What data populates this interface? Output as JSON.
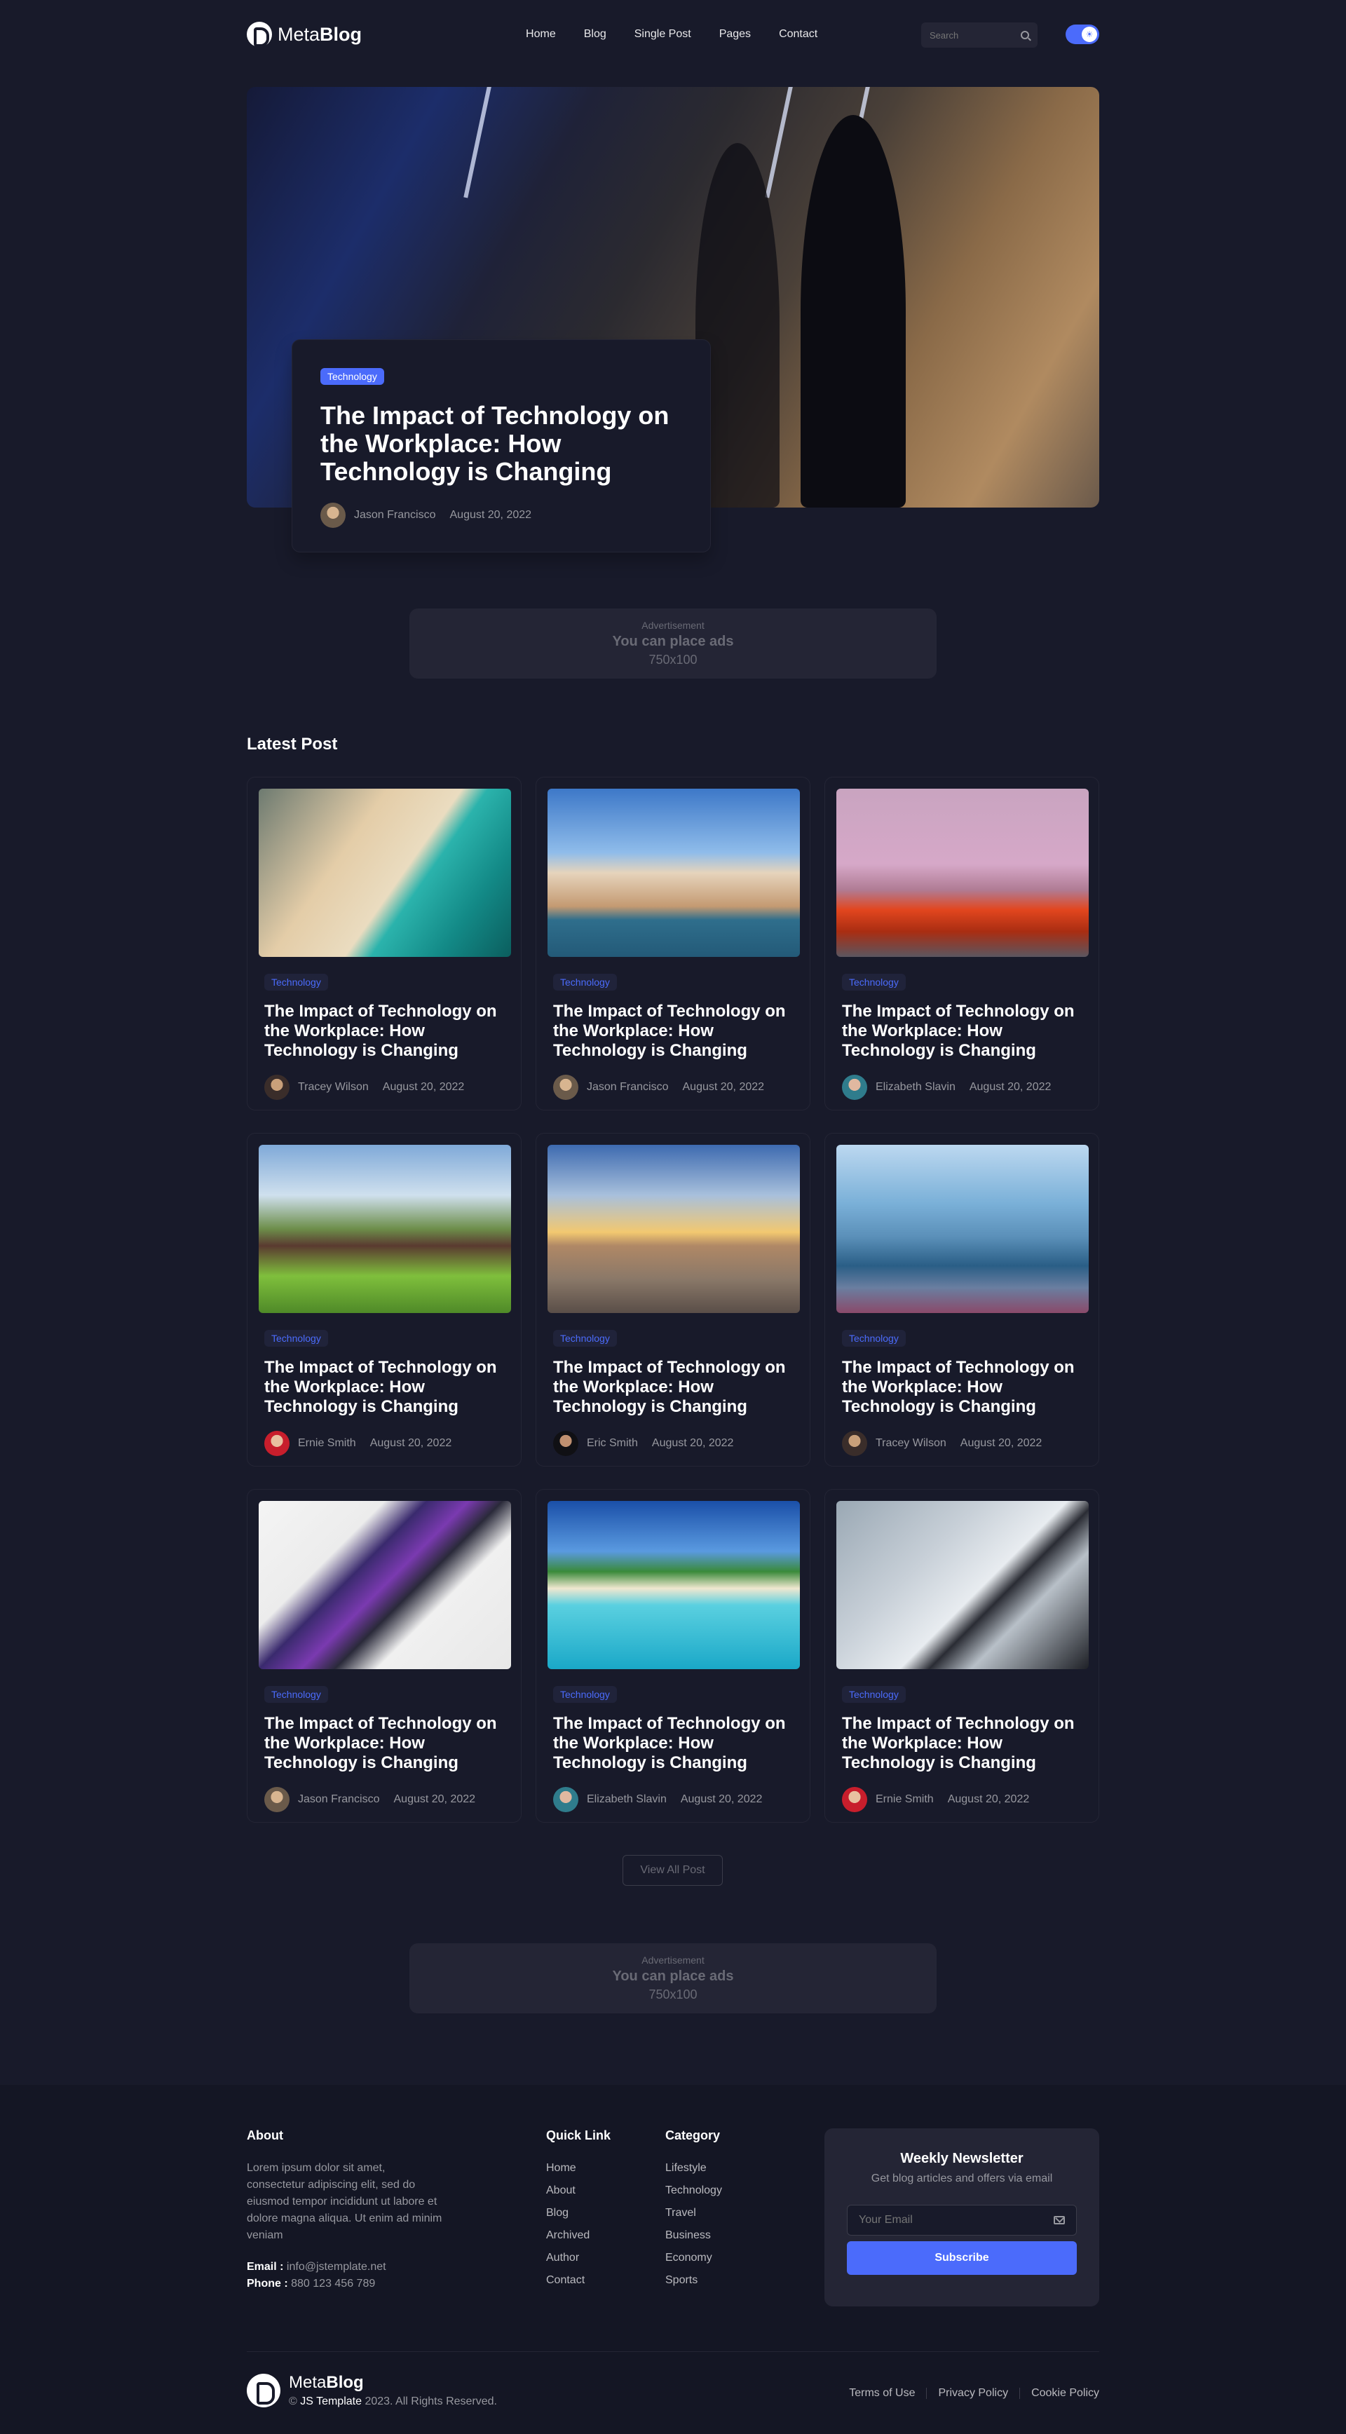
{
  "brand": {
    "prefix": "Meta",
    "bold": "Blog"
  },
  "nav": [
    "Home",
    "Blog",
    "Single Post",
    "Pages",
    "Contact"
  ],
  "search": {
    "placeholder": "Search"
  },
  "hero": {
    "tag": "Technology",
    "title": "The Impact of Technology on the Workplace: How Technology is Changing",
    "author": "Jason Francisco",
    "date": "August 20, 2022"
  },
  "ad": {
    "label": "Advertisement",
    "title": "You can place ads",
    "size": "750x100"
  },
  "latest": {
    "title": "Latest Post",
    "posts": [
      {
        "tag": "Technology",
        "title": "The Impact of Technology on the Workplace: How Technology is Changing",
        "author": "Tracey Wilson",
        "date": "August 20, 2022",
        "image": "beach-aerial"
      },
      {
        "tag": "Technology",
        "title": "The Impact of Technology on the Workplace: How Technology is Changing",
        "author": "Jason Francisco",
        "date": "August 20, 2022",
        "image": "venice-canal"
      },
      {
        "tag": "Technology",
        "title": "The Impact of Technology on the Workplace: How Technology is Changing",
        "author": "Elizabeth Slavin",
        "date": "August 20, 2022",
        "image": "red-car-woman"
      },
      {
        "tag": "Technology",
        "title": "The Impact of Technology on the Workplace: How Technology is Changing",
        "author": "Ernie Smith",
        "date": "August 20, 2022",
        "image": "countryside-house"
      },
      {
        "tag": "Technology",
        "title": "The Impact of Technology on the Workplace: How Technology is Changing",
        "author": "Eric Smith",
        "date": "August 20, 2022",
        "image": "stone-cairn-sunset"
      },
      {
        "tag": "Technology",
        "title": "The Impact of Technology on the Workplace: How Technology is Changing",
        "author": "Tracey Wilson",
        "date": "August 20, 2022",
        "image": "blue-classic-car"
      },
      {
        "tag": "Technology",
        "title": "The Impact of Technology on the Workplace: How Technology is Changing",
        "author": "Jason Francisco",
        "date": "August 20, 2022",
        "image": "smartphone-desk"
      },
      {
        "tag": "Technology",
        "title": "The Impact of Technology on the Workplace: How Technology is Changing",
        "author": "Elizabeth Slavin",
        "date": "August 20, 2022",
        "image": "tropical-island"
      },
      {
        "tag": "Technology",
        "title": "The Impact of Technology on the Workplace: How Technology is Changing",
        "author": "Ernie Smith",
        "date": "August 20, 2022",
        "image": "game-controller"
      }
    ],
    "view_all": "View All Post"
  },
  "footer": {
    "about_title": "About",
    "about_text": "Lorem ipsum dolor sit amet, consectetur adipiscing elit, sed do eiusmod tempor incididunt ut labore et dolore magna aliqua. Ut enim ad minim veniam",
    "email_label": "Email :",
    "email": "info@jstemplate.net",
    "phone_label": "Phone :",
    "phone": "880 123 456 789",
    "quick_title": "Quick Link",
    "quick_links": [
      "Home",
      "About",
      "Blog",
      "Archived",
      "Author",
      "Contact"
    ],
    "category_title": "Category",
    "categories": [
      "Lifestyle",
      "Technology",
      "Travel",
      "Business",
      "Economy",
      "Sports"
    ],
    "newsletter": {
      "title": "Weekly Newsletter",
      "subtitle": "Get blog articles and offers via email",
      "placeholder": "Your Email",
      "button": "Subscribe"
    },
    "copyright_brand": "JS Template",
    "copyright_text": "2023. All Rights Reserved.",
    "legal": [
      "Terms of Use",
      "Privacy Policy",
      "Cookie Policy"
    ]
  },
  "colors": {
    "accent": "#4b6bfb",
    "background": "#181a2a",
    "surface": "#242535"
  }
}
